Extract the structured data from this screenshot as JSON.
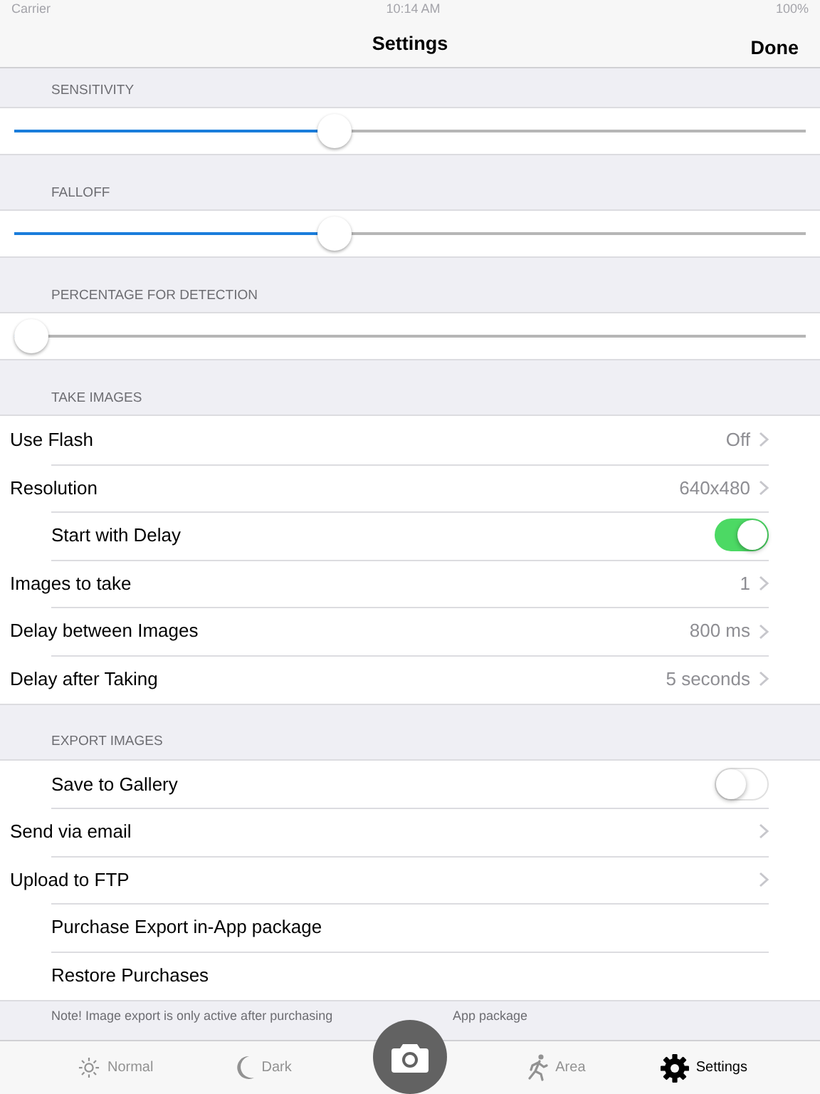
{
  "status_bar": {
    "carrier": "Carrier",
    "time": "10:14 AM",
    "battery": "100%"
  },
  "nav": {
    "title": "Settings",
    "done": "Done"
  },
  "sections": [
    {
      "header": "SENSITIVITY",
      "rows": [
        {
          "kind": "slider",
          "level": 0.4
        }
      ]
    },
    {
      "header": "FALLOFF",
      "rows": [
        {
          "kind": "slider",
          "level": 0.4
        }
      ]
    },
    {
      "header": "PERCENTAGE FOR DETECTION",
      "rows": [
        {
          "kind": "slider",
          "level": 0
        }
      ]
    },
    {
      "header": "TAKE IMAGES",
      "rows": [
        {
          "kind": "detail",
          "label": "Use Flash",
          "value": "Off",
          "indented": false
        },
        {
          "kind": "detail",
          "label": "Resolution",
          "value": "640x480",
          "indented": false
        },
        {
          "kind": "switch",
          "label": "Start with Delay",
          "on": true,
          "indented": true
        },
        {
          "kind": "detail",
          "label": "Images to take",
          "value": "1",
          "indented": false
        },
        {
          "kind": "detail",
          "label": "Delay between Images",
          "value": "800 ms",
          "indented": false
        },
        {
          "kind": "detail",
          "label": "Delay after Taking",
          "value": "5 seconds",
          "indented": false
        }
      ]
    },
    {
      "header": "EXPORT IMAGES",
      "rows": [
        {
          "kind": "switch",
          "label": "Save to Gallery",
          "on": false,
          "indented": true
        },
        {
          "kind": "detail",
          "label": "Send via email",
          "indented": false
        },
        {
          "kind": "detail",
          "label": "Upload to FTP",
          "indented": false
        },
        {
          "kind": "action",
          "label": "Purchase Export in-App package",
          "indented": true
        },
        {
          "kind": "action",
          "label": "Restore Purchases",
          "indented": true
        }
      ]
    }
  ],
  "note": [
    "Note! Image export is only active after purchasing",
    "App package"
  ],
  "tabs": [
    {
      "kind": "sun",
      "label": "Normal",
      "selected": false
    },
    {
      "kind": "moon",
      "label": "Dark",
      "selected": false
    },
    {
      "kind": "camera"
    },
    {
      "kind": "runner",
      "label": "Area",
      "selected": false
    },
    {
      "kind": "gear",
      "label": "Settings",
      "selected": true
    }
  ]
}
